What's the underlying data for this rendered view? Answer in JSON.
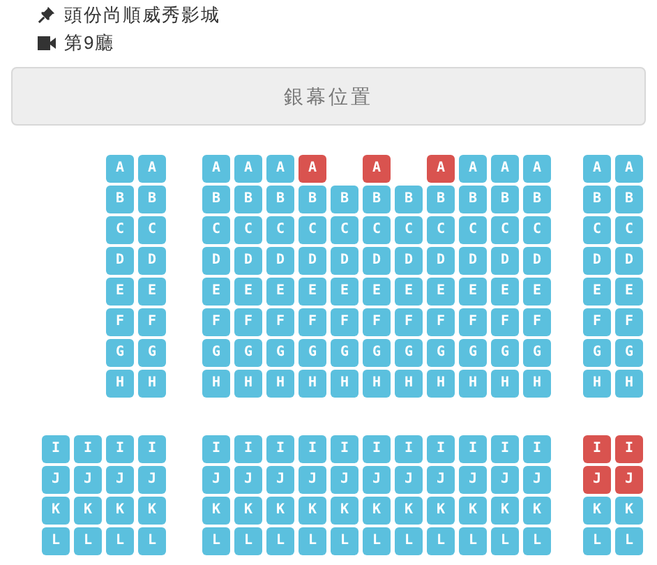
{
  "cinema": {
    "name": "頭份尚順威秀影城",
    "hall": "第9廳"
  },
  "screen": {
    "label": "銀幕位置"
  },
  "sections": [
    {
      "rows": [
        {
          "blocks": [
            [
              {
                "kind": "seat",
                "label": "A",
                "taken": false
              },
              {
                "kind": "seat",
                "label": "A",
                "taken": false
              }
            ],
            [
              {
                "kind": "seat",
                "label": "A",
                "taken": false
              },
              {
                "kind": "seat",
                "label": "A",
                "taken": false
              },
              {
                "kind": "seat",
                "label": "A",
                "taken": false
              },
              {
                "kind": "seat",
                "label": "A",
                "taken": true
              },
              {
                "kind": "gap"
              },
              {
                "kind": "seat",
                "label": "A",
                "taken": true
              },
              {
                "kind": "gap"
              },
              {
                "kind": "seat",
                "label": "A",
                "taken": true
              },
              {
                "kind": "seat",
                "label": "A",
                "taken": false
              },
              {
                "kind": "seat",
                "label": "A",
                "taken": false
              },
              {
                "kind": "seat",
                "label": "A",
                "taken": false
              }
            ],
            [
              {
                "kind": "seat",
                "label": "A",
                "taken": false
              },
              {
                "kind": "seat",
                "label": "A",
                "taken": false
              }
            ]
          ]
        },
        {
          "blocks": [
            [
              {
                "kind": "seat",
                "label": "B",
                "taken": false
              },
              {
                "kind": "seat",
                "label": "B",
                "taken": false
              }
            ],
            [
              {
                "kind": "seat",
                "label": "B",
                "taken": false
              },
              {
                "kind": "seat",
                "label": "B",
                "taken": false
              },
              {
                "kind": "seat",
                "label": "B",
                "taken": false
              },
              {
                "kind": "seat",
                "label": "B",
                "taken": false
              },
              {
                "kind": "seat",
                "label": "B",
                "taken": false
              },
              {
                "kind": "seat",
                "label": "B",
                "taken": false
              },
              {
                "kind": "seat",
                "label": "B",
                "taken": false
              },
              {
                "kind": "seat",
                "label": "B",
                "taken": false
              },
              {
                "kind": "seat",
                "label": "B",
                "taken": false
              },
              {
                "kind": "seat",
                "label": "B",
                "taken": false
              },
              {
                "kind": "seat",
                "label": "B",
                "taken": false
              }
            ],
            [
              {
                "kind": "seat",
                "label": "B",
                "taken": false
              },
              {
                "kind": "seat",
                "label": "B",
                "taken": false
              }
            ]
          ]
        },
        {
          "blocks": [
            [
              {
                "kind": "seat",
                "label": "C",
                "taken": false
              },
              {
                "kind": "seat",
                "label": "C",
                "taken": false
              }
            ],
            [
              {
                "kind": "seat",
                "label": "C",
                "taken": false
              },
              {
                "kind": "seat",
                "label": "C",
                "taken": false
              },
              {
                "kind": "seat",
                "label": "C",
                "taken": false
              },
              {
                "kind": "seat",
                "label": "C",
                "taken": false
              },
              {
                "kind": "seat",
                "label": "C",
                "taken": false
              },
              {
                "kind": "seat",
                "label": "C",
                "taken": false
              },
              {
                "kind": "seat",
                "label": "C",
                "taken": false
              },
              {
                "kind": "seat",
                "label": "C",
                "taken": false
              },
              {
                "kind": "seat",
                "label": "C",
                "taken": false
              },
              {
                "kind": "seat",
                "label": "C",
                "taken": false
              },
              {
                "kind": "seat",
                "label": "C",
                "taken": false
              }
            ],
            [
              {
                "kind": "seat",
                "label": "C",
                "taken": false
              },
              {
                "kind": "seat",
                "label": "C",
                "taken": false
              }
            ]
          ]
        },
        {
          "blocks": [
            [
              {
                "kind": "seat",
                "label": "D",
                "taken": false
              },
              {
                "kind": "seat",
                "label": "D",
                "taken": false
              }
            ],
            [
              {
                "kind": "seat",
                "label": "D",
                "taken": false
              },
              {
                "kind": "seat",
                "label": "D",
                "taken": false
              },
              {
                "kind": "seat",
                "label": "D",
                "taken": false
              },
              {
                "kind": "seat",
                "label": "D",
                "taken": false
              },
              {
                "kind": "seat",
                "label": "D",
                "taken": false
              },
              {
                "kind": "seat",
                "label": "D",
                "taken": false
              },
              {
                "kind": "seat",
                "label": "D",
                "taken": false
              },
              {
                "kind": "seat",
                "label": "D",
                "taken": false
              },
              {
                "kind": "seat",
                "label": "D",
                "taken": false
              },
              {
                "kind": "seat",
                "label": "D",
                "taken": false
              },
              {
                "kind": "seat",
                "label": "D",
                "taken": false
              }
            ],
            [
              {
                "kind": "seat",
                "label": "D",
                "taken": false
              },
              {
                "kind": "seat",
                "label": "D",
                "taken": false
              }
            ]
          ]
        },
        {
          "blocks": [
            [
              {
                "kind": "seat",
                "label": "E",
                "taken": false
              },
              {
                "kind": "seat",
                "label": "E",
                "taken": false
              }
            ],
            [
              {
                "kind": "seat",
                "label": "E",
                "taken": false
              },
              {
                "kind": "seat",
                "label": "E",
                "taken": false
              },
              {
                "kind": "seat",
                "label": "E",
                "taken": false
              },
              {
                "kind": "seat",
                "label": "E",
                "taken": false
              },
              {
                "kind": "seat",
                "label": "E",
                "taken": false
              },
              {
                "kind": "seat",
                "label": "E",
                "taken": false
              },
              {
                "kind": "seat",
                "label": "E",
                "taken": false
              },
              {
                "kind": "seat",
                "label": "E",
                "taken": false
              },
              {
                "kind": "seat",
                "label": "E",
                "taken": false
              },
              {
                "kind": "seat",
                "label": "E",
                "taken": false
              },
              {
                "kind": "seat",
                "label": "E",
                "taken": false
              }
            ],
            [
              {
                "kind": "seat",
                "label": "E",
                "taken": false
              },
              {
                "kind": "seat",
                "label": "E",
                "taken": false
              }
            ]
          ]
        },
        {
          "blocks": [
            [
              {
                "kind": "seat",
                "label": "F",
                "taken": false
              },
              {
                "kind": "seat",
                "label": "F",
                "taken": false
              }
            ],
            [
              {
                "kind": "seat",
                "label": "F",
                "taken": false
              },
              {
                "kind": "seat",
                "label": "F",
                "taken": false
              },
              {
                "kind": "seat",
                "label": "F",
                "taken": false
              },
              {
                "kind": "seat",
                "label": "F",
                "taken": false
              },
              {
                "kind": "seat",
                "label": "F",
                "taken": false
              },
              {
                "kind": "seat",
                "label": "F",
                "taken": false
              },
              {
                "kind": "seat",
                "label": "F",
                "taken": false
              },
              {
                "kind": "seat",
                "label": "F",
                "taken": false
              },
              {
                "kind": "seat",
                "label": "F",
                "taken": false
              },
              {
                "kind": "seat",
                "label": "F",
                "taken": false
              },
              {
                "kind": "seat",
                "label": "F",
                "taken": false
              }
            ],
            [
              {
                "kind": "seat",
                "label": "F",
                "taken": false
              },
              {
                "kind": "seat",
                "label": "F",
                "taken": false
              }
            ]
          ]
        },
        {
          "blocks": [
            [
              {
                "kind": "seat",
                "label": "G",
                "taken": false
              },
              {
                "kind": "seat",
                "label": "G",
                "taken": false
              }
            ],
            [
              {
                "kind": "seat",
                "label": "G",
                "taken": false
              },
              {
                "kind": "seat",
                "label": "G",
                "taken": false
              },
              {
                "kind": "seat",
                "label": "G",
                "taken": false
              },
              {
                "kind": "seat",
                "label": "G",
                "taken": false
              },
              {
                "kind": "seat",
                "label": "G",
                "taken": false
              },
              {
                "kind": "seat",
                "label": "G",
                "taken": false
              },
              {
                "kind": "seat",
                "label": "G",
                "taken": false
              },
              {
                "kind": "seat",
                "label": "G",
                "taken": false
              },
              {
                "kind": "seat",
                "label": "G",
                "taken": false
              },
              {
                "kind": "seat",
                "label": "G",
                "taken": false
              },
              {
                "kind": "seat",
                "label": "G",
                "taken": false
              }
            ],
            [
              {
                "kind": "seat",
                "label": "G",
                "taken": false
              },
              {
                "kind": "seat",
                "label": "G",
                "taken": false
              }
            ]
          ]
        },
        {
          "blocks": [
            [
              {
                "kind": "seat",
                "label": "H",
                "taken": false
              },
              {
                "kind": "seat",
                "label": "H",
                "taken": false
              }
            ],
            [
              {
                "kind": "seat",
                "label": "H",
                "taken": false
              },
              {
                "kind": "seat",
                "label": "H",
                "taken": false
              },
              {
                "kind": "seat",
                "label": "H",
                "taken": false
              },
              {
                "kind": "seat",
                "label": "H",
                "taken": false
              },
              {
                "kind": "seat",
                "label": "H",
                "taken": false
              },
              {
                "kind": "seat",
                "label": "H",
                "taken": false
              },
              {
                "kind": "seat",
                "label": "H",
                "taken": false
              },
              {
                "kind": "seat",
                "label": "H",
                "taken": false
              },
              {
                "kind": "seat",
                "label": "H",
                "taken": false
              },
              {
                "kind": "seat",
                "label": "H",
                "taken": false
              },
              {
                "kind": "seat",
                "label": "H",
                "taken": false
              }
            ],
            [
              {
                "kind": "seat",
                "label": "H",
                "taken": false
              },
              {
                "kind": "seat",
                "label": "H",
                "taken": false
              }
            ]
          ]
        }
      ]
    },
    {
      "rows": [
        {
          "blocks": [
            [
              {
                "kind": "seat",
                "label": "I",
                "taken": false
              },
              {
                "kind": "seat",
                "label": "I",
                "taken": false
              },
              {
                "kind": "seat",
                "label": "I",
                "taken": false
              },
              {
                "kind": "seat",
                "label": "I",
                "taken": false
              }
            ],
            [
              {
                "kind": "seat",
                "label": "I",
                "taken": false
              },
              {
                "kind": "seat",
                "label": "I",
                "taken": false
              },
              {
                "kind": "seat",
                "label": "I",
                "taken": false
              },
              {
                "kind": "seat",
                "label": "I",
                "taken": false
              },
              {
                "kind": "seat",
                "label": "I",
                "taken": false
              },
              {
                "kind": "seat",
                "label": "I",
                "taken": false
              },
              {
                "kind": "seat",
                "label": "I",
                "taken": false
              },
              {
                "kind": "seat",
                "label": "I",
                "taken": false
              },
              {
                "kind": "seat",
                "label": "I",
                "taken": false
              },
              {
                "kind": "seat",
                "label": "I",
                "taken": false
              },
              {
                "kind": "seat",
                "label": "I",
                "taken": false
              }
            ],
            [
              {
                "kind": "seat",
                "label": "I",
                "taken": true
              },
              {
                "kind": "seat",
                "label": "I",
                "taken": true
              }
            ]
          ]
        },
        {
          "blocks": [
            [
              {
                "kind": "seat",
                "label": "J",
                "taken": false
              },
              {
                "kind": "seat",
                "label": "J",
                "taken": false
              },
              {
                "kind": "seat",
                "label": "J",
                "taken": false
              },
              {
                "kind": "seat",
                "label": "J",
                "taken": false
              }
            ],
            [
              {
                "kind": "seat",
                "label": "J",
                "taken": false
              },
              {
                "kind": "seat",
                "label": "J",
                "taken": false
              },
              {
                "kind": "seat",
                "label": "J",
                "taken": false
              },
              {
                "kind": "seat",
                "label": "J",
                "taken": false
              },
              {
                "kind": "seat",
                "label": "J",
                "taken": false
              },
              {
                "kind": "seat",
                "label": "J",
                "taken": false
              },
              {
                "kind": "seat",
                "label": "J",
                "taken": false
              },
              {
                "kind": "seat",
                "label": "J",
                "taken": false
              },
              {
                "kind": "seat",
                "label": "J",
                "taken": false
              },
              {
                "kind": "seat",
                "label": "J",
                "taken": false
              },
              {
                "kind": "seat",
                "label": "J",
                "taken": false
              }
            ],
            [
              {
                "kind": "seat",
                "label": "J",
                "taken": true
              },
              {
                "kind": "seat",
                "label": "J",
                "taken": true
              }
            ]
          ]
        },
        {
          "blocks": [
            [
              {
                "kind": "seat",
                "label": "K",
                "taken": false
              },
              {
                "kind": "seat",
                "label": "K",
                "taken": false
              },
              {
                "kind": "seat",
                "label": "K",
                "taken": false
              },
              {
                "kind": "seat",
                "label": "K",
                "taken": false
              }
            ],
            [
              {
                "kind": "seat",
                "label": "K",
                "taken": false
              },
              {
                "kind": "seat",
                "label": "K",
                "taken": false
              },
              {
                "kind": "seat",
                "label": "K",
                "taken": false
              },
              {
                "kind": "seat",
                "label": "K",
                "taken": false
              },
              {
                "kind": "seat",
                "label": "K",
                "taken": false
              },
              {
                "kind": "seat",
                "label": "K",
                "taken": false
              },
              {
                "kind": "seat",
                "label": "K",
                "taken": false
              },
              {
                "kind": "seat",
                "label": "K",
                "taken": false
              },
              {
                "kind": "seat",
                "label": "K",
                "taken": false
              },
              {
                "kind": "seat",
                "label": "K",
                "taken": false
              },
              {
                "kind": "seat",
                "label": "K",
                "taken": false
              }
            ],
            [
              {
                "kind": "seat",
                "label": "K",
                "taken": false
              },
              {
                "kind": "seat",
                "label": "K",
                "taken": false
              }
            ]
          ]
        },
        {
          "blocks": [
            [
              {
                "kind": "seat",
                "label": "L",
                "taken": false
              },
              {
                "kind": "seat",
                "label": "L",
                "taken": false
              },
              {
                "kind": "seat",
                "label": "L",
                "taken": false
              },
              {
                "kind": "seat",
                "label": "L",
                "taken": false
              }
            ],
            [
              {
                "kind": "seat",
                "label": "L",
                "taken": false
              },
              {
                "kind": "seat",
                "label": "L",
                "taken": false
              },
              {
                "kind": "seat",
                "label": "L",
                "taken": false
              },
              {
                "kind": "seat",
                "label": "L",
                "taken": false
              },
              {
                "kind": "seat",
                "label": "L",
                "taken": false
              },
              {
                "kind": "seat",
                "label": "L",
                "taken": false
              },
              {
                "kind": "seat",
                "label": "L",
                "taken": false
              },
              {
                "kind": "seat",
                "label": "L",
                "taken": false
              },
              {
                "kind": "seat",
                "label": "L",
                "taken": false
              },
              {
                "kind": "seat",
                "label": "L",
                "taken": false
              },
              {
                "kind": "seat",
                "label": "L",
                "taken": false
              }
            ],
            [
              {
                "kind": "seat",
                "label": "L",
                "taken": false
              },
              {
                "kind": "seat",
                "label": "L",
                "taken": false
              }
            ]
          ]
        }
      ]
    }
  ]
}
